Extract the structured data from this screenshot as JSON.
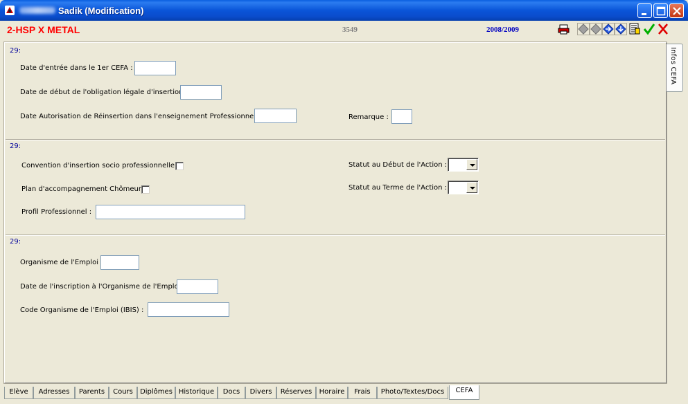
{
  "window": {
    "title": "Sadik (Modification)"
  },
  "info": {
    "class_name": "2-HSP  X METAL",
    "record_number": "3549",
    "school_year": "2008/2009"
  },
  "sections": {
    "s1": {
      "label": "29:",
      "date_entree_label": "Date d'entrée dans le 1er CEFA :",
      "date_entree_value": "",
      "date_debut_label": "Date de début de l'obligation légale d'insertion :",
      "date_debut_value": "",
      "date_autorisation_label": "Date Autorisation de Réinsertion dans l'enseignement Professionnel :",
      "date_autorisation_value": "",
      "remarque_label": "Remarque :",
      "remarque_value": ""
    },
    "s2": {
      "label": "29:",
      "convention_label": "Convention d'insertion socio professionnelle :",
      "plan_label": "Plan d'accompagnement Chômeur :",
      "profil_label": "Profil Professionnel :",
      "profil_value": "",
      "statut_debut_label": "Statut au Début de l'Action :",
      "statut_debut_value": "",
      "statut_terme_label": "Statut au Terme de l'Action :",
      "statut_terme_value": ""
    },
    "s3": {
      "label": "29:",
      "organisme_label": "Organisme de l'Emploi :",
      "organisme_value": "",
      "date_inscription_label": "Date de l'inscription à l'Organisme de l'Emploi :",
      "date_inscription_value": "",
      "code_label": "Code Organisme de l'Emploi (IBIS) :",
      "code_value": ""
    }
  },
  "side_tab": {
    "label": "Infos CEFA"
  },
  "tabs": [
    {
      "label": "Elève"
    },
    {
      "label": "Adresses"
    },
    {
      "label": "Parents"
    },
    {
      "label": "Cours"
    },
    {
      "label": "Diplômes"
    },
    {
      "label": "Historique"
    },
    {
      "label": "Docs"
    },
    {
      "label": "Divers"
    },
    {
      "label": "Réserves"
    },
    {
      "label": "Horaire"
    },
    {
      "label": "Frais"
    },
    {
      "label": "Photo/Textes/Docs"
    },
    {
      "label": "CEFA"
    }
  ],
  "active_tab": "CEFA",
  "colors": {
    "titlebar": "#0a55d8",
    "class_name": "#ff0000",
    "record_number": "#808080",
    "school_year": "#0000c0",
    "section_label": "#00009a",
    "background": "#ece9d8"
  },
  "icons": {
    "window": "app-icon",
    "print": "printer-icon",
    "first": "diamond-gray-icon",
    "previous": "diamond-gray-icon",
    "next": "arrow-right-icon",
    "last": "arrow-down-icon",
    "notes": "notes-icon",
    "validate": "check-icon",
    "cancel": "cross-icon"
  }
}
